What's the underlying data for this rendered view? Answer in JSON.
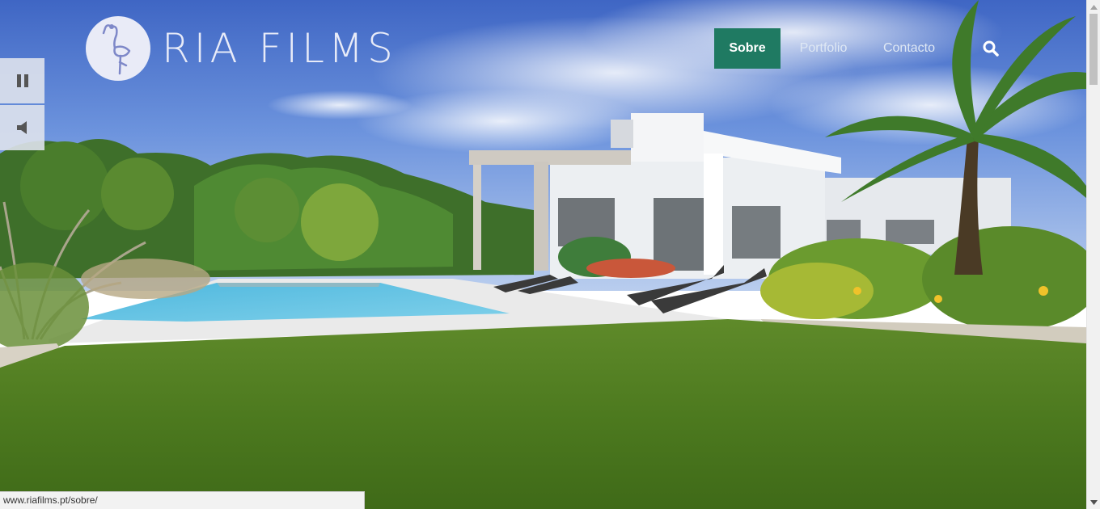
{
  "brand": {
    "name": "RIA FILMS",
    "logo_icon": "flamingo-icon"
  },
  "nav": {
    "items": [
      {
        "label": "Sobre",
        "active": true
      },
      {
        "label": "Portfolio",
        "active": false
      },
      {
        "label": "Contacto",
        "active": false
      }
    ],
    "search_icon": "search-icon",
    "active_color": "#1f7a62"
  },
  "media_controls": {
    "pause_icon": "pause-icon",
    "mute_icon": "volume-icon"
  },
  "status_bar": {
    "url": "www.riafilms.pt/sobre/"
  }
}
